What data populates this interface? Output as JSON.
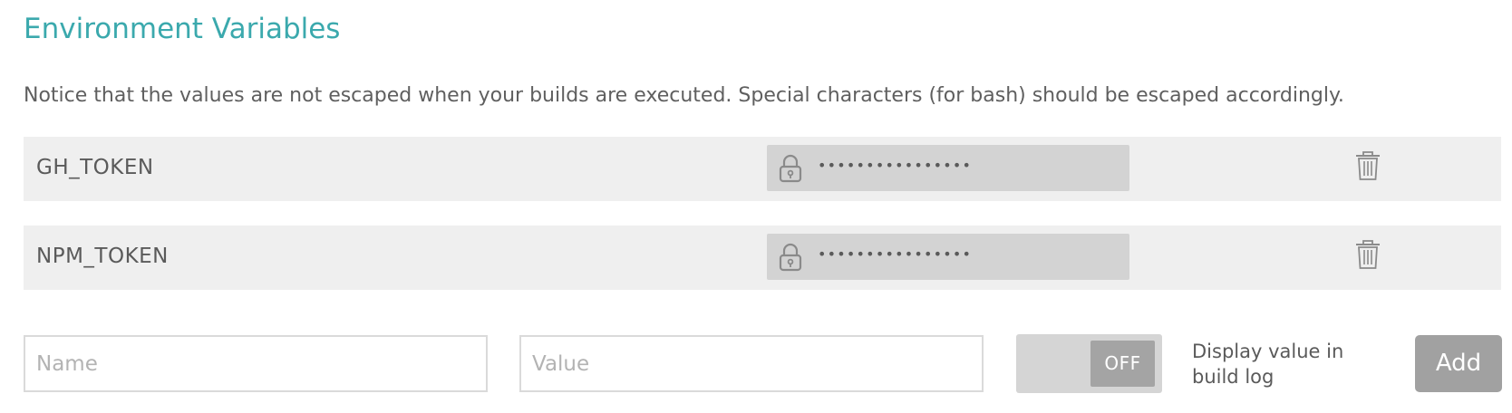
{
  "page": {
    "title": "Environment Variables",
    "notice": "Notice that the values are not escaped when your builds are executed. Special characters (for bash) should be escaped accordingly."
  },
  "env_vars": [
    {
      "name": "GH_TOKEN",
      "value_masked": "••••••••••••••••",
      "icons": {
        "lock": "lock-icon",
        "delete": "trash-icon"
      }
    },
    {
      "name": "NPM_TOKEN",
      "value_masked": "••••••••••••••••",
      "icons": {
        "lock": "lock-icon",
        "delete": "trash-icon"
      }
    }
  ],
  "new_var": {
    "name_placeholder": "Name",
    "value_placeholder": "Value",
    "toggle_state": "OFF",
    "toggle_label": "Display value in build log",
    "add_label": "Add"
  },
  "colors": {
    "title": "#3ba9ad",
    "row_bg": "#efefef",
    "value_bg": "#d3d3d3",
    "button_bg": "#a1a1a1"
  }
}
